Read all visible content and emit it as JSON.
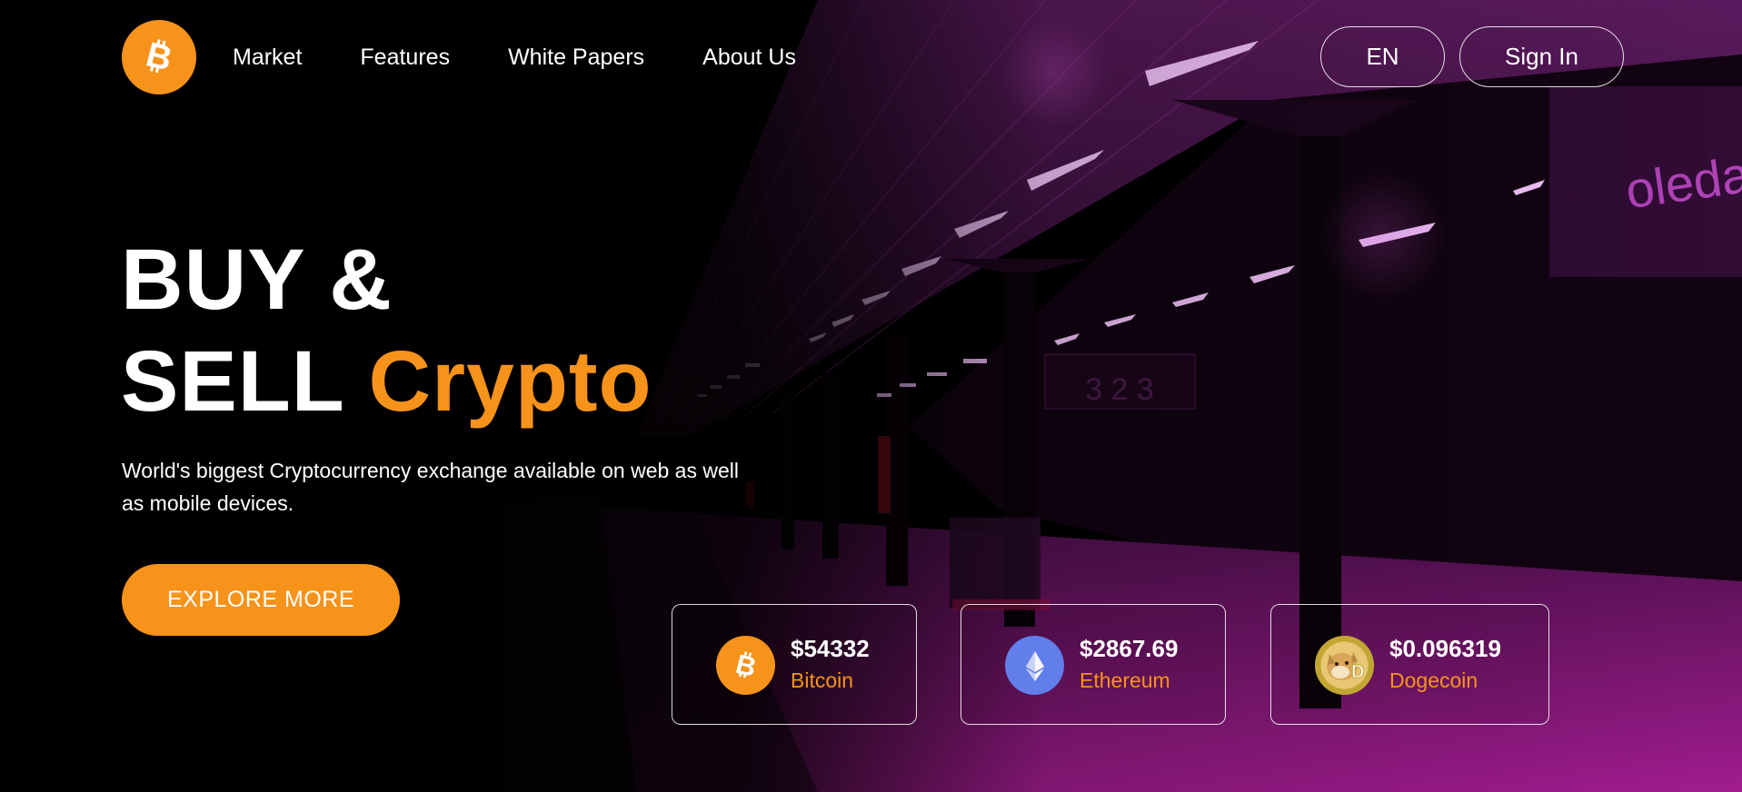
{
  "brand": {
    "logo_icon": "bitcoin-icon",
    "accent": "#f7931a"
  },
  "nav": {
    "items": [
      {
        "label": "Market"
      },
      {
        "label": "Features"
      },
      {
        "label": "White Papers"
      },
      {
        "label": "About Us"
      }
    ],
    "language_label": "EN",
    "signin_label": "Sign In"
  },
  "hero": {
    "title_line1": "BUY &",
    "title_line2_plain": "SELL",
    "title_line2_accent": "Crypto",
    "subtitle": "World's biggest Cryptocurrency exchange available on web as well as mobile devices.",
    "cta_label": "EXPLORE MORE"
  },
  "coins": [
    {
      "price": "$54332",
      "name": "Bitcoin",
      "icon": "bitcoin-icon",
      "color": "#f7931a"
    },
    {
      "price": "$2867.69",
      "name": "Ethereum",
      "icon": "ethereum-icon",
      "color": "#627eea"
    },
    {
      "price": "$0.096319",
      "name": "Dogecoin",
      "icon": "dogecoin-icon",
      "color": "#c2a633"
    }
  ],
  "background": {
    "signage_text": "oleda",
    "platform_numbers": "3 2 3"
  }
}
